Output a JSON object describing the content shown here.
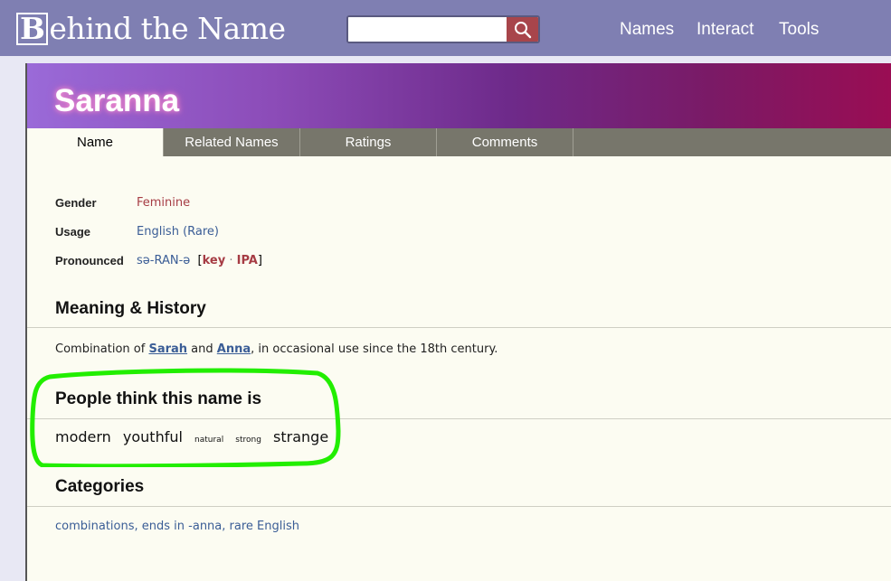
{
  "header": {
    "logo_initial": "B",
    "logo_rest": "ehind the Name",
    "search": {
      "value": "",
      "placeholder": ""
    },
    "nav": [
      "Names",
      "Interact",
      "Tools"
    ]
  },
  "name": "Saranna",
  "tabs": [
    "Name",
    "Related Names",
    "Ratings",
    "Comments"
  ],
  "info": {
    "gender_label": "Gender",
    "gender_value": "Feminine",
    "usage_label": "Usage",
    "usage_value": "English (Rare)",
    "pronounced_label": "Pronounced",
    "pronounced_value": "sə-RAN-ə",
    "bracket_open": "[",
    "key_link": "key",
    "sep": "·",
    "ipa_link": "IPA",
    "bracket_close": "]"
  },
  "meaning": {
    "heading": "Meaning & History",
    "prefix": "Combination of ",
    "link1": "Sarah",
    "mid": " and ",
    "link2": "Anna",
    "suffix": ", in occasional use since the 18th century."
  },
  "people_think": {
    "heading": "People think this name is",
    "tags": [
      "modern",
      "youthful",
      "natural",
      "strong",
      "strange"
    ]
  },
  "categories": {
    "heading": "Categories",
    "items": [
      "combinations",
      "ends in -anna",
      "rare English"
    ]
  },
  "colors": {
    "header_bg": "#7f7fb2",
    "search_button": "#a8454b",
    "tab_bar": "#77766b",
    "content_bg": "#fcfcf2",
    "link_blue": "#3a5d96",
    "link_red": "#a63c44",
    "highlight": "#22ee00"
  }
}
